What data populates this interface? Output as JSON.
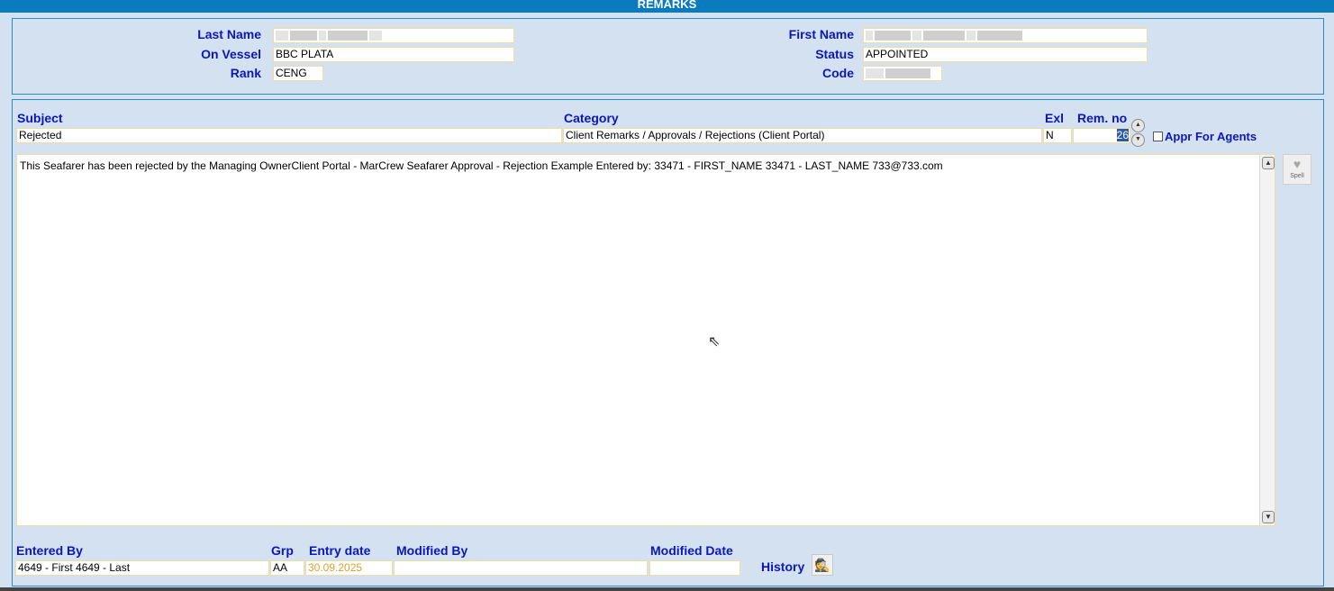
{
  "window": {
    "title": "REMARKS"
  },
  "header": {
    "last_name_label": "Last Name",
    "on_vessel_label": "On Vessel",
    "on_vessel_value": "BBC PLATA",
    "rank_label": "Rank",
    "rank_value": "CENG",
    "first_name_label": "First Name",
    "status_label": "Status",
    "status_value": "APPOINTED",
    "code_label": "Code"
  },
  "remark": {
    "subject_label": "Subject",
    "subject_value": "Rejected",
    "category_label": "Category",
    "category_value": "Client Remarks / Approvals / Rejections (Client Portal)",
    "exl_label": "Exl",
    "exl_value": "N",
    "rem_no_label": "Rem. no",
    "rem_no_value": "26",
    "appr_for_agents_label": "Appr For Agents",
    "appr_for_agents_checked": false,
    "text": "This Seafarer has been rejected by the Managing OwnerClient Portal - MarCrew Seafarer Approval - Rejection Example Entered by: 33471 - FIRST_NAME 33471 - LAST_NAME 733@733.com",
    "spell_label": "Spell"
  },
  "footer": {
    "entered_by_label": "Entered By",
    "entered_by_value": "4649 - First 4649 - Last",
    "grp_label": "Grp",
    "grp_value": "AA",
    "entry_date_label": "Entry date",
    "entry_date_value": "30.09.2025",
    "modified_by_label": "Modified By",
    "modified_by_value": "",
    "modified_date_label": "Modified Date",
    "modified_date_value": "",
    "history_label": "History"
  },
  "icons": [
    "spin-up-icon",
    "spin-down-icon",
    "scroll-up-icon",
    "scroll-down-icon",
    "spell-check-icon",
    "history-icon",
    "mouse-cursor-icon"
  ],
  "colors": {
    "titlebar": "#0a7bbd",
    "label": "#0c17b8",
    "background": "#d3e1f0",
    "field_border": "#f2dca0",
    "date_text": "#e0a030"
  }
}
